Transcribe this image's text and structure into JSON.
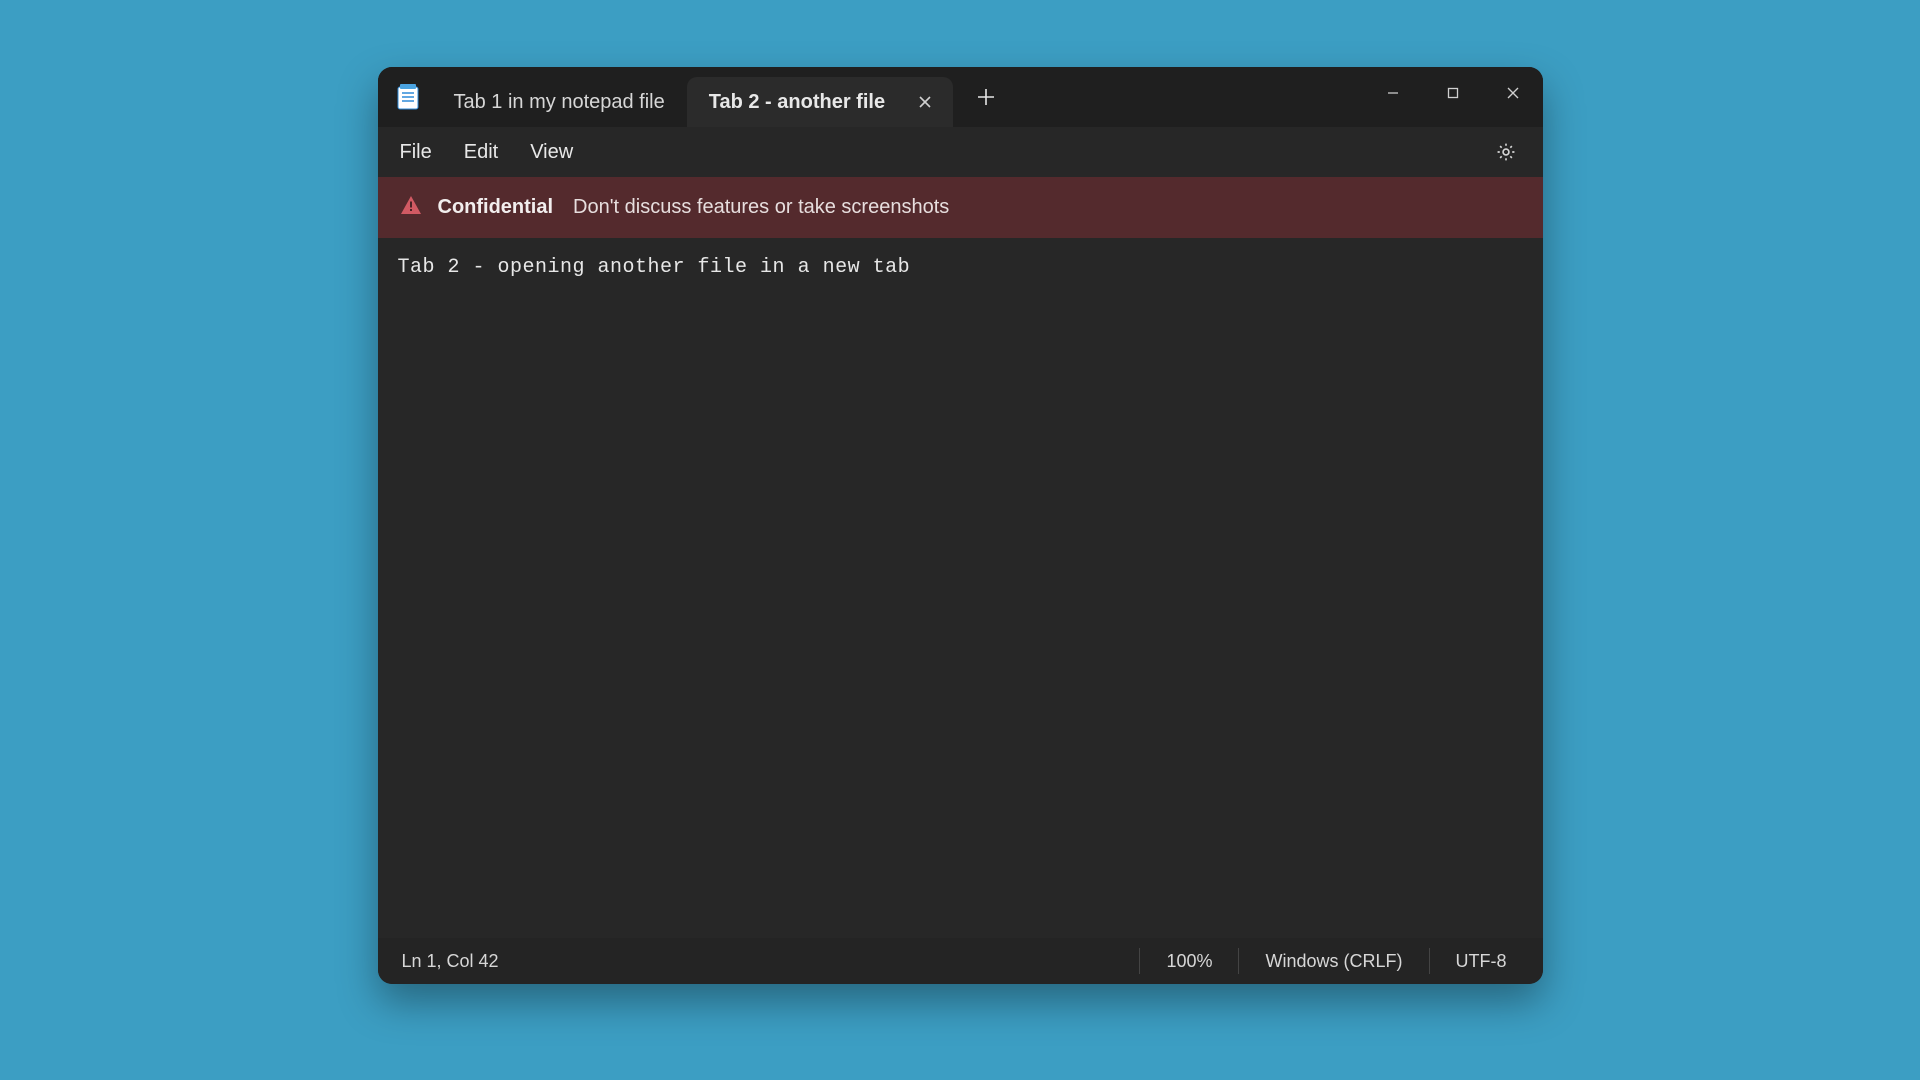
{
  "tabs": [
    {
      "label": "Tab 1 in my notepad file",
      "active": false
    },
    {
      "label": "Tab 2 - another file",
      "active": true
    }
  ],
  "menu": {
    "file": "File",
    "edit": "Edit",
    "view": "View"
  },
  "banner": {
    "title": "Confidential",
    "message": "Don't discuss features or take screenshots"
  },
  "editor": {
    "content": "Tab 2 - opening another file in a new tab"
  },
  "status": {
    "cursor": "Ln 1, Col 42",
    "zoom": "100%",
    "line_ending": "Windows (CRLF)",
    "encoding": "UTF-8"
  }
}
